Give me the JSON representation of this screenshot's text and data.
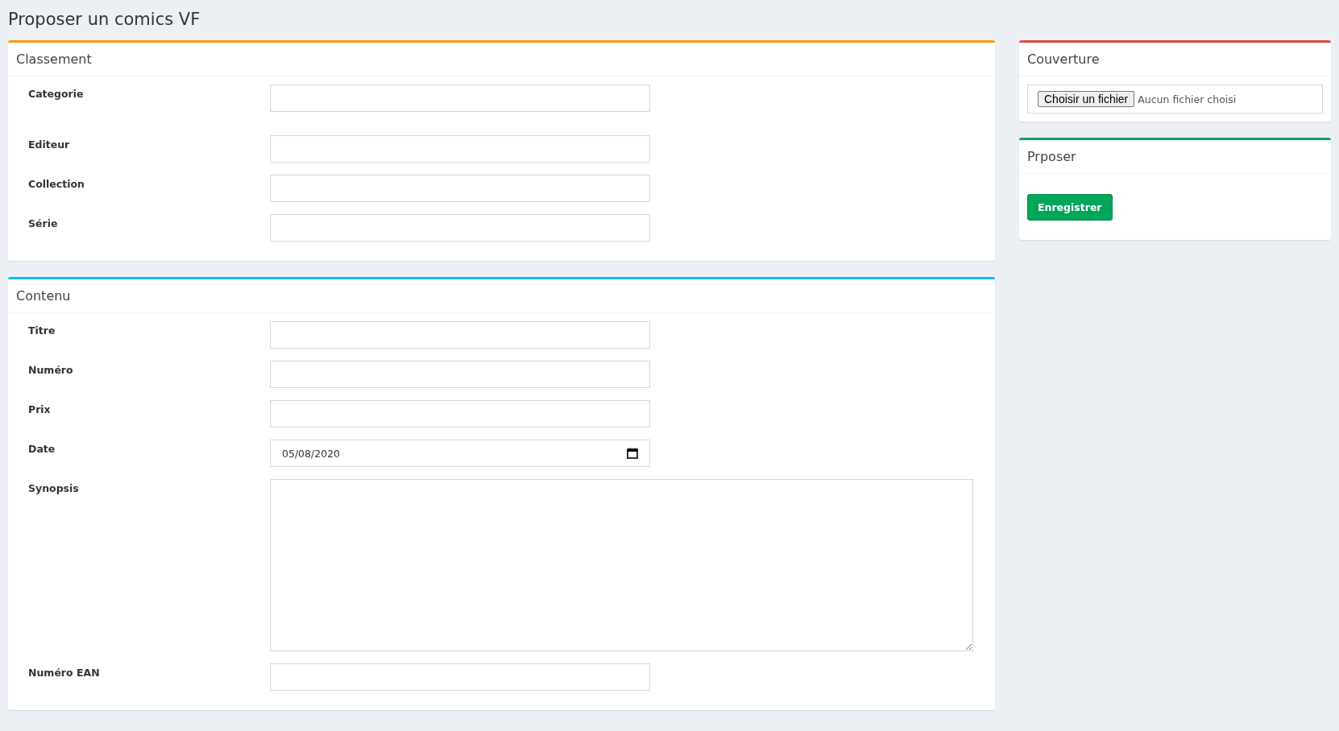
{
  "page_title": "Proposer un comics VF",
  "main_cards": [
    {
      "title": "Classement",
      "color": "#f39c12",
      "fields": [
        {
          "label": "Categorie",
          "kind": "text"
        },
        {
          "label": "Editeur",
          "kind": "text"
        },
        {
          "label": "Collection",
          "kind": "text"
        },
        {
          "label": "Série",
          "kind": "text"
        }
      ]
    },
    {
      "title": "Contenu",
      "color": "#00c0ef",
      "fields": [
        {
          "label": "Titre",
          "kind": "text"
        },
        {
          "label": "Numéro",
          "kind": "text"
        },
        {
          "label": "Prix",
          "kind": "text"
        },
        {
          "label": "Date",
          "kind": "date",
          "value": "05/08/2020"
        },
        {
          "label": "Synopsis",
          "kind": "textarea"
        },
        {
          "label": "Numéro EAN",
          "kind": "text"
        }
      ]
    }
  ],
  "cover_card": {
    "title": "Couverture",
    "color": "#dd4b39",
    "file_button": "Choisir un fichier",
    "file_status": "Aucun fichier choisi"
  },
  "submit_card": {
    "title": "Prposer",
    "color": "#00a65a",
    "button": "Enregistrer"
  }
}
